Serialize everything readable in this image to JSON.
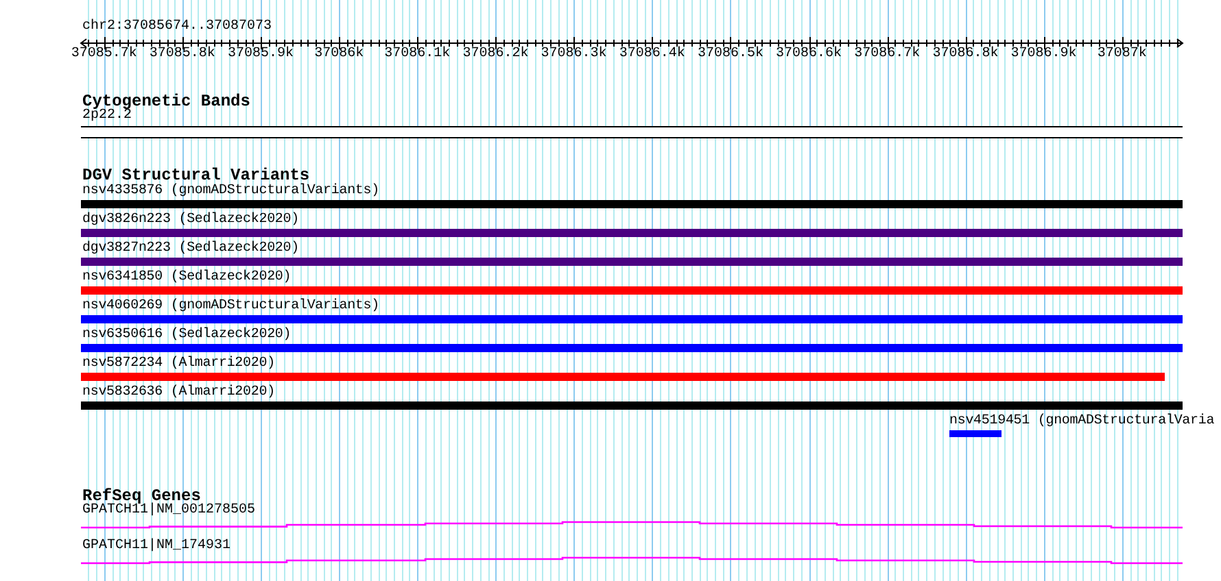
{
  "location": "chr2:37085674..37087073",
  "ruler": {
    "ticks": [
      "37085.7k",
      "37085.8k",
      "37085.9k",
      "37086k",
      "37086.1k",
      "37086.2k",
      "37086.3k",
      "37086.4k",
      "37086.5k",
      "37086.6k",
      "37086.7k",
      "37086.8k",
      "37086.9k",
      "37087k"
    ]
  },
  "tracks": [
    {
      "kind": "band",
      "title": "Cytogenetic Bands",
      "features": [
        {
          "label": "2p22.2"
        }
      ]
    },
    {
      "kind": "variants",
      "title": "DGV Structural Variants",
      "features": [
        {
          "label": "nsv4335876 (gnomADStructuralVariants)",
          "color": "#000000"
        },
        {
          "label": "dgv3826n223 (Sedlazeck2020)",
          "color": "#4b0082"
        },
        {
          "label": "dgv3827n223 (Sedlazeck2020)",
          "color": "#4b0082"
        },
        {
          "label": "nsv6341850 (Sedlazeck2020)",
          "color": "#ff0000"
        },
        {
          "label": "nsv4060269 (gnomADStructuralVariants)",
          "color": "#0000ff"
        },
        {
          "label": "nsv6350616 (Sedlazeck2020)",
          "color": "#0000ff"
        },
        {
          "label": "nsv5872234 (Almarri2020)",
          "color": "#ff0000"
        },
        {
          "label": "nsv5832636 (Almarri2020)",
          "color": "#000000"
        },
        {
          "label": "nsv4519451 (gnomADStructuralVaria",
          "color": "#0000ff"
        }
      ]
    },
    {
      "kind": "genes",
      "title": "RefSeq Genes",
      "features": [
        {
          "label": "GPATCH11|NM_001278505"
        },
        {
          "label": "GPATCH11|NM_174931"
        }
      ]
    }
  ]
}
